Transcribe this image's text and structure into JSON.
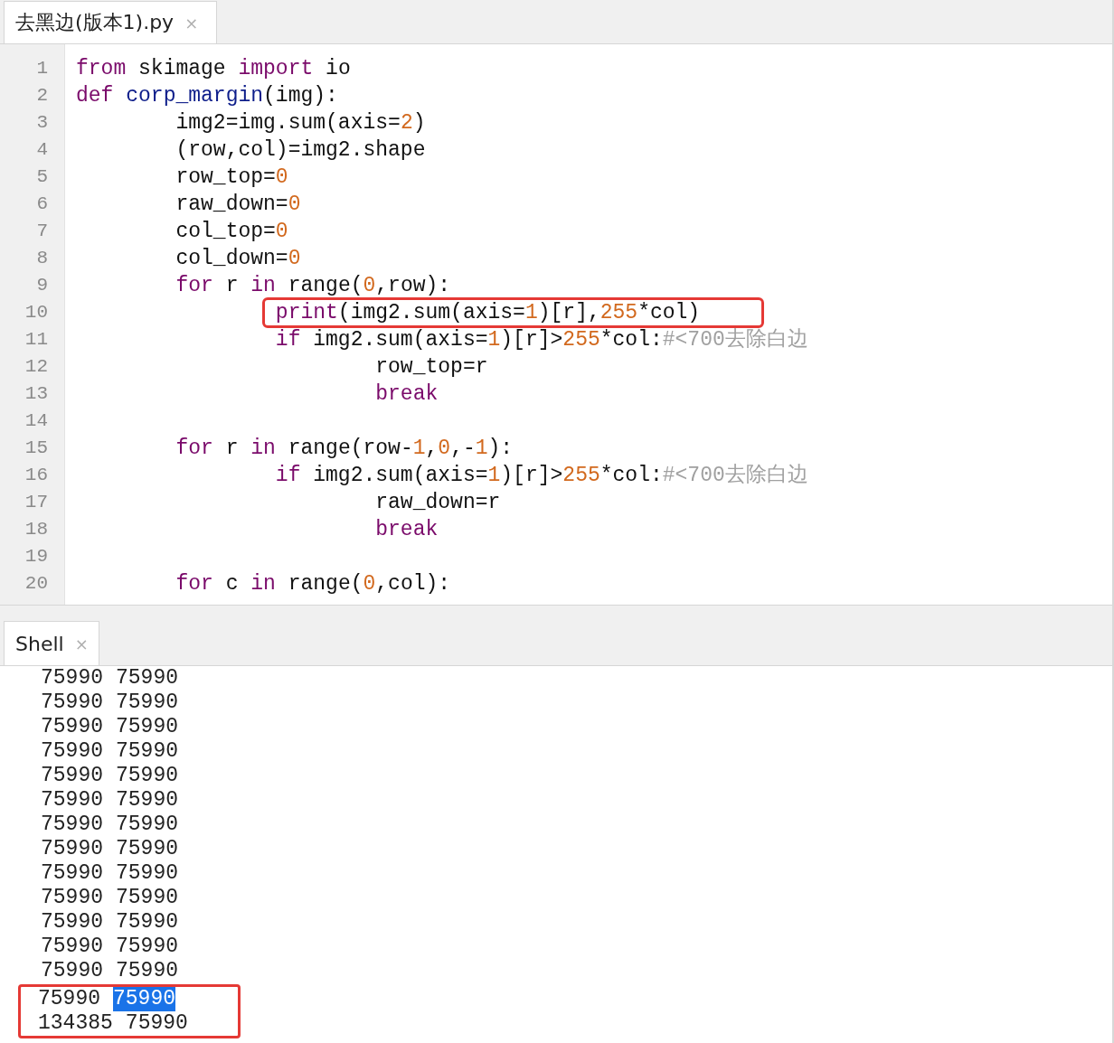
{
  "editor": {
    "tabs": [
      {
        "label": "去黑边(版本1).py",
        "close": "×",
        "selected": true
      }
    ],
    "lines": [
      {
        "number": "1",
        "highlighted": false,
        "tokens": [
          {
            "kind": "kw",
            "text": "from"
          },
          {
            "kind": "text",
            "text": " skimage "
          },
          {
            "kind": "kw",
            "text": "import"
          },
          {
            "kind": "text",
            "text": " io"
          }
        ]
      },
      {
        "number": "2",
        "highlighted": false,
        "tokens": [
          {
            "kind": "kw",
            "text": "def"
          },
          {
            "kind": "fn",
            "text": " corp_margin"
          },
          {
            "kind": "text",
            "text": "(img):"
          }
        ]
      },
      {
        "number": "3",
        "highlighted": false,
        "tokens": [
          {
            "kind": "text",
            "text": "        img2=img.sum(axis="
          },
          {
            "kind": "num",
            "text": "2"
          },
          {
            "kind": "text",
            "text": ")"
          }
        ]
      },
      {
        "number": "4",
        "highlighted": false,
        "tokens": [
          {
            "kind": "text",
            "text": "        (row,col)=img2.shape"
          }
        ]
      },
      {
        "number": "5",
        "highlighted": false,
        "tokens": [
          {
            "kind": "text",
            "text": "        row_top="
          },
          {
            "kind": "num",
            "text": "0"
          }
        ]
      },
      {
        "number": "6",
        "highlighted": false,
        "tokens": [
          {
            "kind": "text",
            "text": "        raw_down="
          },
          {
            "kind": "num",
            "text": "0"
          }
        ]
      },
      {
        "number": "7",
        "highlighted": false,
        "tokens": [
          {
            "kind": "text",
            "text": "        col_top="
          },
          {
            "kind": "num",
            "text": "0"
          }
        ]
      },
      {
        "number": "8",
        "highlighted": false,
        "tokens": [
          {
            "kind": "text",
            "text": "        col_down="
          },
          {
            "kind": "num",
            "text": "0"
          }
        ]
      },
      {
        "number": "9",
        "highlighted": false,
        "tokens": [
          {
            "kind": "kw",
            "text": "        for"
          },
          {
            "kind": "text",
            "text": " r "
          },
          {
            "kind": "kw",
            "text": "in"
          },
          {
            "kind": "text",
            "text": " range("
          },
          {
            "kind": "num",
            "text": "0"
          },
          {
            "kind": "text",
            "text": ",row):"
          }
        ]
      },
      {
        "number": "10",
        "highlighted": true,
        "tokens": [
          {
            "kind": "kw",
            "text": "                print"
          },
          {
            "kind": "text",
            "text": "(img2.sum(axis="
          },
          {
            "kind": "num",
            "text": "1"
          },
          {
            "kind": "text",
            "text": ")[r],"
          },
          {
            "kind": "num",
            "text": "255"
          },
          {
            "kind": "text",
            "text": "*col)"
          }
        ]
      },
      {
        "number": "11",
        "highlighted": false,
        "tokens": [
          {
            "kind": "kw",
            "text": "                if"
          },
          {
            "kind": "text",
            "text": " img2.sum(axis="
          },
          {
            "kind": "num",
            "text": "1"
          },
          {
            "kind": "text",
            "text": ")[r]>"
          },
          {
            "kind": "num",
            "text": "255"
          },
          {
            "kind": "text",
            "text": "*col:"
          },
          {
            "kind": "comment",
            "text": "#<700去除白边"
          }
        ]
      },
      {
        "number": "12",
        "highlighted": false,
        "tokens": [
          {
            "kind": "text",
            "text": "                        row_top=r"
          }
        ]
      },
      {
        "number": "13",
        "highlighted": false,
        "tokens": [
          {
            "kind": "kw",
            "text": "                        break"
          }
        ]
      },
      {
        "number": "14",
        "highlighted": false
      },
      {
        "number": "15",
        "highlighted": false,
        "tokens": [
          {
            "kind": "kw",
            "text": "        for"
          },
          {
            "kind": "text",
            "text": " r "
          },
          {
            "kind": "kw",
            "text": "in"
          },
          {
            "kind": "text",
            "text": " range(row-"
          },
          {
            "kind": "num",
            "text": "1"
          },
          {
            "kind": "text",
            "text": ","
          },
          {
            "kind": "num",
            "text": "0"
          },
          {
            "kind": "text",
            "text": ",-"
          },
          {
            "kind": "num",
            "text": "1"
          },
          {
            "kind": "text",
            "text": "):"
          }
        ]
      },
      {
        "number": "16",
        "highlighted": false,
        "tokens": [
          {
            "kind": "kw",
            "text": "                if"
          },
          {
            "kind": "text",
            "text": " img2.sum(axis="
          },
          {
            "kind": "num",
            "text": "1"
          },
          {
            "kind": "text",
            "text": ")[r]>"
          },
          {
            "kind": "num",
            "text": "255"
          },
          {
            "kind": "text",
            "text": "*col:"
          },
          {
            "kind": "comment",
            "text": "#<700去除白边"
          }
        ]
      },
      {
        "number": "17",
        "highlighted": false,
        "tokens": [
          {
            "kind": "text",
            "text": "                        raw_down=r"
          }
        ]
      },
      {
        "number": "18",
        "highlighted": false,
        "tokens": [
          {
            "kind": "kw",
            "text": "                        break"
          }
        ]
      },
      {
        "number": "19",
        "highlighted": false
      },
      {
        "number": "20",
        "highlighted": false,
        "tokens": [
          {
            "kind": "kw",
            "text": "        for"
          },
          {
            "kind": "text",
            "text": " c "
          },
          {
            "kind": "kw",
            "text": "in"
          },
          {
            "kind": "text",
            "text": " range("
          },
          {
            "kind": "num",
            "text": "0"
          },
          {
            "kind": "text",
            "text": ",col):"
          }
        ]
      }
    ]
  },
  "shell": {
    "tabs": [
      {
        "label": "Shell",
        "close": "×",
        "selected": true
      }
    ],
    "lines": [
      {
        "boxed": false,
        "values": [
          {
            "text": "75990",
            "selected": false
          },
          {
            "text": "75990",
            "selected": false
          }
        ]
      },
      {
        "boxed": false,
        "values": [
          {
            "text": "75990",
            "selected": false
          },
          {
            "text": "75990",
            "selected": false
          }
        ]
      },
      {
        "boxed": false,
        "values": [
          {
            "text": "75990",
            "selected": false
          },
          {
            "text": "75990",
            "selected": false
          }
        ]
      },
      {
        "boxed": false,
        "values": [
          {
            "text": "75990",
            "selected": false
          },
          {
            "text": "75990",
            "selected": false
          }
        ]
      },
      {
        "boxed": false,
        "values": [
          {
            "text": "75990",
            "selected": false
          },
          {
            "text": "75990",
            "selected": false
          }
        ]
      },
      {
        "boxed": false,
        "values": [
          {
            "text": "75990",
            "selected": false
          },
          {
            "text": "75990",
            "selected": false
          }
        ]
      },
      {
        "boxed": false,
        "values": [
          {
            "text": "75990",
            "selected": false
          },
          {
            "text": "75990",
            "selected": false
          }
        ]
      },
      {
        "boxed": false,
        "values": [
          {
            "text": "75990",
            "selected": false
          },
          {
            "text": "75990",
            "selected": false
          }
        ]
      },
      {
        "boxed": false,
        "values": [
          {
            "text": "75990",
            "selected": false
          },
          {
            "text": "75990",
            "selected": false
          }
        ]
      },
      {
        "boxed": false,
        "values": [
          {
            "text": "75990",
            "selected": false
          },
          {
            "text": "75990",
            "selected": false
          }
        ]
      },
      {
        "boxed": false,
        "values": [
          {
            "text": "75990",
            "selected": false
          },
          {
            "text": "75990",
            "selected": false
          }
        ]
      },
      {
        "boxed": false,
        "values": [
          {
            "text": "75990",
            "selected": false
          },
          {
            "text": "75990",
            "selected": false
          }
        ]
      },
      {
        "boxed": false,
        "values": [
          {
            "text": "75990",
            "selected": false
          },
          {
            "text": "75990",
            "selected": false
          }
        ]
      },
      {
        "boxed": true,
        "values": [
          {
            "text": "75990",
            "selected": false
          },
          {
            "text": "75990",
            "selected": true
          }
        ]
      },
      {
        "boxed": true,
        "values": [
          {
            "text": "134385",
            "selected": false
          },
          {
            "text": "75990",
            "selected": false
          }
        ]
      }
    ]
  }
}
